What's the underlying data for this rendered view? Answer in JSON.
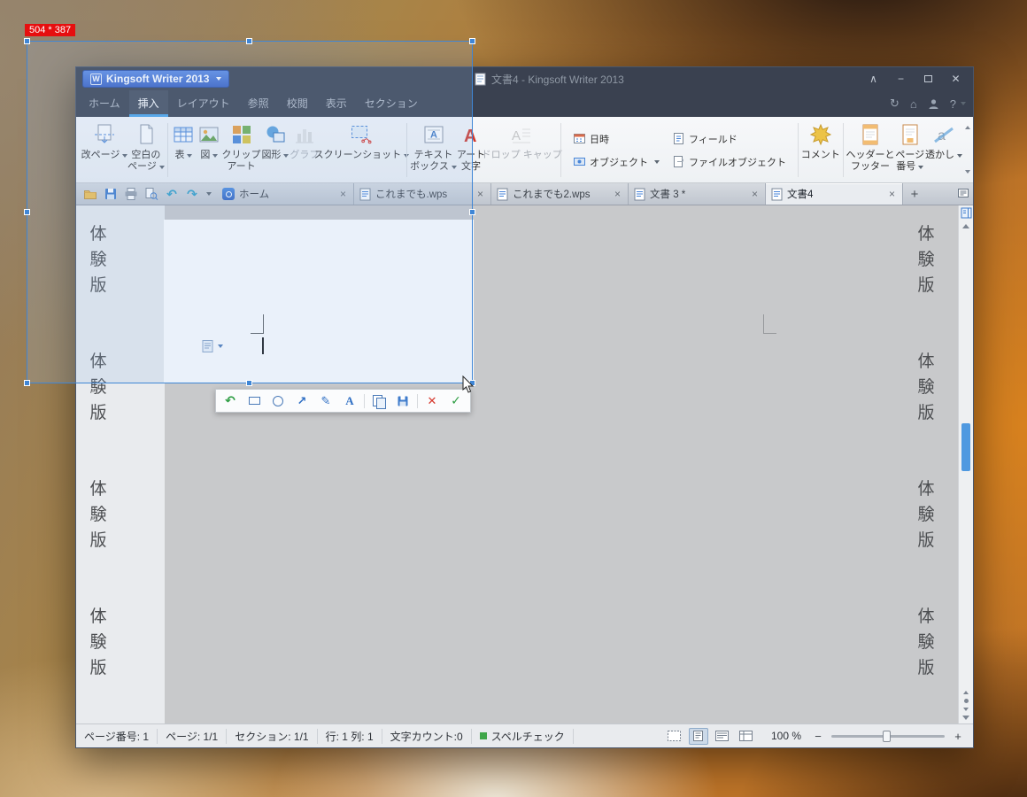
{
  "glyphs": {
    "logo_w": "W",
    "collapse": "∧",
    "minimize": "−",
    "close": "✕",
    "tab_close": "×",
    "new_tab": "+",
    "undo": "↶",
    "redo": "↷",
    "refresh": "↻",
    "home": "⌂",
    "help": "?",
    "icon_a": "A",
    "icon_a_small": "a",
    "anno_undo": "↶",
    "anno_arrow": "↗",
    "anno_pen": "✎",
    "anno_text": "A",
    "anno_cancel": "✕",
    "anno_ok": "✓",
    "zoom_minus": "−",
    "zoom_plus": "+"
  },
  "capture": {
    "size_label": "504 * 387"
  },
  "window": {
    "titlebar": {
      "app_button": "Kingsoft Writer 2013",
      "document_title": "文書4 - Kingsoft Writer 2013"
    },
    "menu": {
      "tabs": [
        "ホーム",
        "挿入",
        "レイアウト",
        "参照",
        "校閲",
        "表示",
        "セクション"
      ],
      "active_tab": "挿入"
    },
    "ribbon": {
      "page_break": "改ページ",
      "blank_page_l1": "空白の",
      "blank_page_l2": "ページ",
      "table": "表",
      "picture": "図",
      "clipart_l1": "クリップ",
      "clipart_l2": "アート",
      "shapes": "図形",
      "chart": "グラフ",
      "screenshot": "スクリーンショット",
      "textbox_l1": "テキスト",
      "textbox_l2": "ボックス",
      "wordart_l1": "アート",
      "wordart_l2": "文字",
      "dropcap": "ドロップ キャップ",
      "datetime": "日時",
      "field": "フィールド",
      "object": "オブジェクト",
      "file_object": "ファイルオブジェクト",
      "comment": "コメント",
      "header_footer_l1": "ヘッダーと",
      "header_footer_l2": "フッター",
      "page_number_l1": "ページ",
      "page_number_l2": "番号",
      "watermark": "透かし"
    },
    "doc_tabs": [
      {
        "label": "ホーム"
      },
      {
        "label": "これまでも.wps"
      },
      {
        "label": "これまでも2.wps"
      },
      {
        "label": "文書 3 *"
      },
      {
        "label": "文書4"
      }
    ],
    "document": {
      "watermark": [
        "体",
        "験",
        "版"
      ]
    },
    "status_bar": {
      "page_no": "ページ番号: 1",
      "page": "ページ: 1/1",
      "section": "セクション:  1/1",
      "line_col": "行: 1 列: 1",
      "char_count": "文字カウント:0",
      "spellcheck": "スペルチェック",
      "zoom_value": "100 %"
    }
  }
}
